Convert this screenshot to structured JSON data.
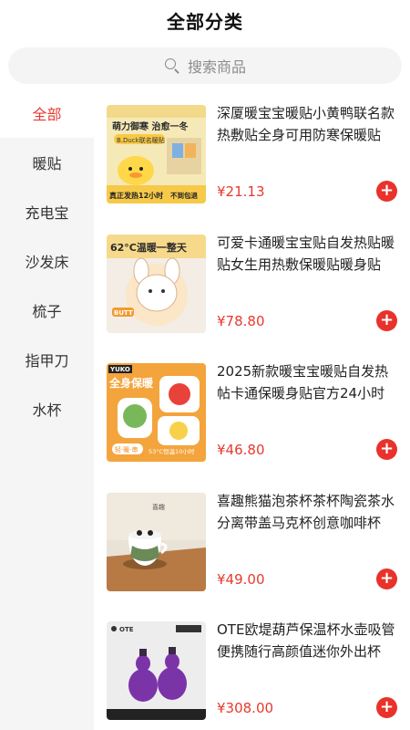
{
  "header": {
    "title": "全部分类"
  },
  "search": {
    "placeholder": "搜索商品",
    "icon": "search-icon"
  },
  "sidebar": {
    "items": [
      {
        "label": "全部",
        "active": true
      },
      {
        "label": "暖贴",
        "active": false
      },
      {
        "label": "充电宝",
        "active": false
      },
      {
        "label": "沙发床",
        "active": false
      },
      {
        "label": "梳子",
        "active": false
      },
      {
        "label": "指甲刀",
        "active": false
      },
      {
        "label": "水杯",
        "active": false
      }
    ]
  },
  "products": [
    {
      "name": "深厦暖宝宝暖贴小黄鸭联名款热敷贴全身可用防寒保暖贴",
      "price": "¥21.13",
      "image_text": [
        "萌力御寒 治愈一冬",
        "B.Duck联名暖贴",
        "真正发热12小时",
        "不到包退"
      ]
    },
    {
      "name": "可爱卡通暖宝宝贴自发热贴暖贴女生用热敷保暖贴暖身贴",
      "price": "¥78.80",
      "image_text": [
        "62°C温暖一整天",
        "BUTT"
      ]
    },
    {
      "name": "2025新款暖宝宝暖贴自发热帖卡通保暖身贴官方24小时",
      "price": "¥46.80",
      "image_text": [
        "全身保暖",
        "YUKO",
        "轻·暖·串",
        "53°C恒温10小时"
      ]
    },
    {
      "name": "喜趣熊猫泡茶杯茶杯陶瓷茶水分离带盖马克杯创意咖啡杯",
      "price": "¥49.00",
      "image_text": [
        "喜趣"
      ]
    },
    {
      "name": "OTE欧堤葫芦保温杯水壶吸管便携随行高颜值迷你外出杯",
      "price": "¥308.00",
      "image_text": [
        "OTE"
      ]
    }
  ],
  "colors": {
    "accent": "#e8392f",
    "sidebar_bg": "#f5f5f5",
    "search_bg": "#f4f4f4"
  }
}
